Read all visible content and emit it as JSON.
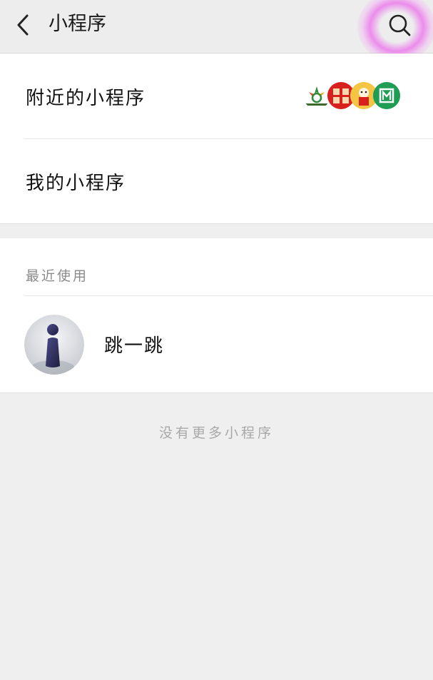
{
  "header": {
    "title": "小程序",
    "back_icon": "chevron-left-icon",
    "search_icon": "search-icon",
    "highlight_color": "#ee44ee"
  },
  "menu": {
    "nearby_label": "附近的小程序",
    "mine_label": "我的小程序",
    "nearby_logos": [
      {
        "name": "Golden Sun",
        "color": "#2e8b3a"
      },
      {
        "name": "金鑫房产",
        "color": "#d8201c"
      },
      {
        "name": "mascot",
        "color": "#e8a020"
      },
      {
        "name": "M-logo",
        "color": "#1f9d55"
      }
    ]
  },
  "recent": {
    "header": "最近使用",
    "items": [
      {
        "name": "跳一跳"
      }
    ]
  },
  "footer": {
    "text": "没有更多小程序"
  }
}
